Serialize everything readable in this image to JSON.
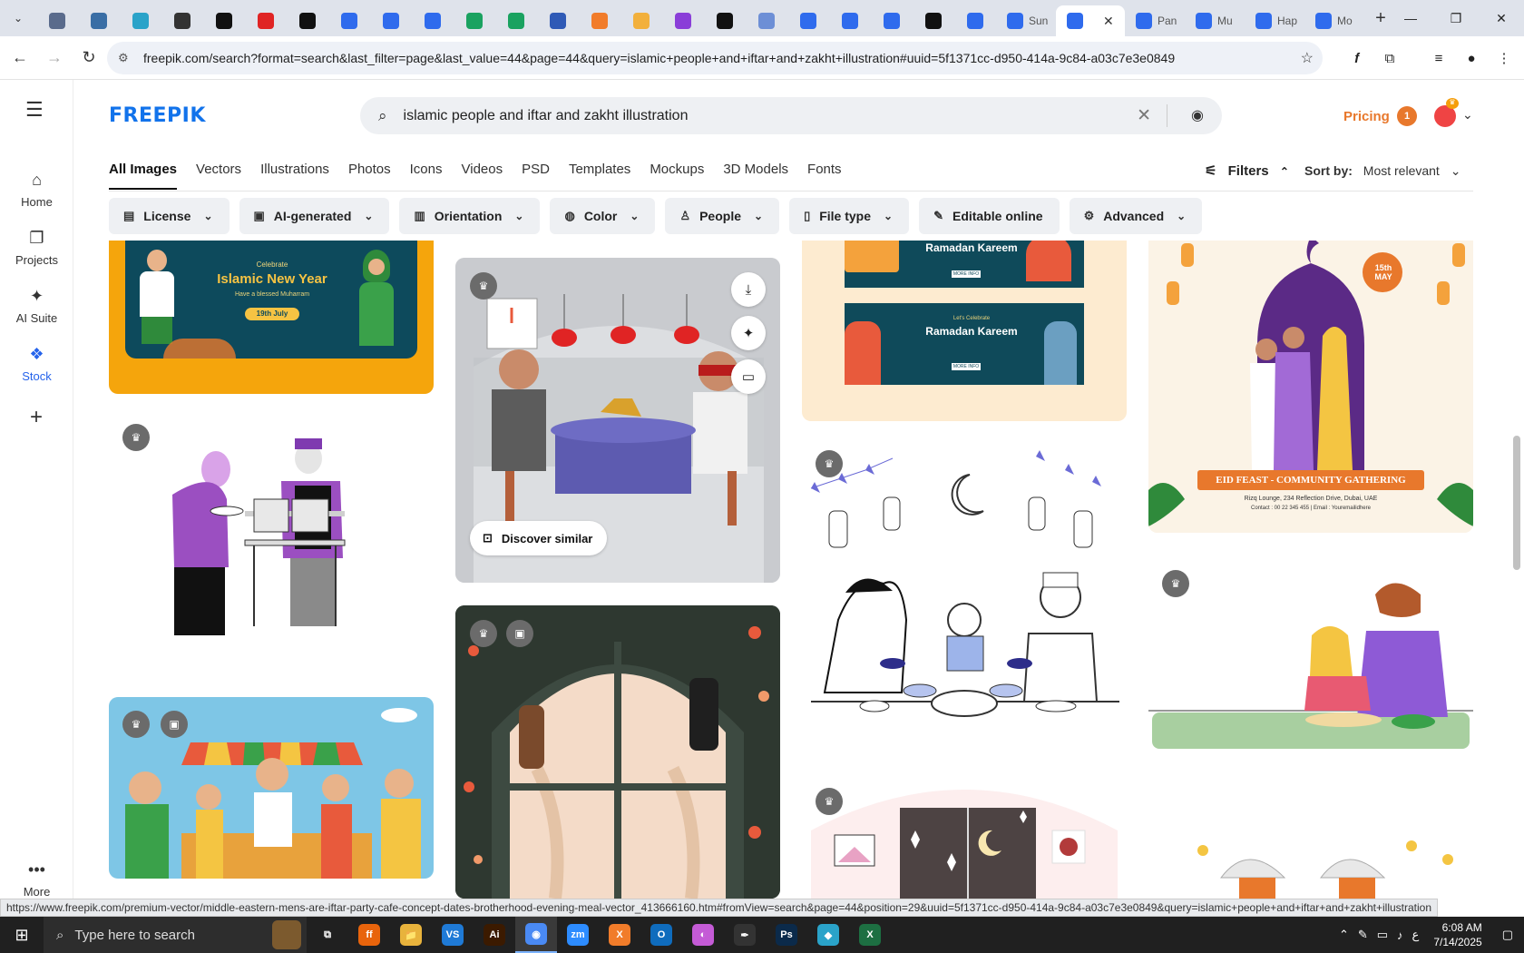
{
  "browser": {
    "tabs": [
      {
        "icon": "chrome-generic-icon",
        "color": "#5a6b8c"
      },
      {
        "icon": "vpn-icon",
        "color": "#3a6ea5"
      },
      {
        "icon": "shield-icon",
        "color": "#2aa3c9"
      },
      {
        "icon": "kaspersky-icon",
        "color": "#333"
      },
      {
        "icon": "github-icon",
        "color": "#111"
      },
      {
        "icon": "youtube-icon",
        "color": "#e02424"
      },
      {
        "icon": "bolt-icon",
        "color": "#111"
      },
      {
        "icon": "docs-icon",
        "color": "#2f6bed"
      },
      {
        "icon": "docs-icon",
        "color": "#2f6bed"
      },
      {
        "icon": "docs-icon",
        "color": "#2f6bed"
      },
      {
        "icon": "sheets-icon",
        "color": "#1aa260"
      },
      {
        "icon": "sheets-icon",
        "color": "#1aa260"
      },
      {
        "icon": "word-icon",
        "color": "#2f5ab6"
      },
      {
        "icon": "xampp-icon",
        "color": "#f17c2a"
      },
      {
        "icon": "bolt-icon",
        "color": "#f2b03c"
      },
      {
        "icon": "bracket-icon",
        "color": "#8a3ed8"
      },
      {
        "icon": "tool-icon",
        "color": "#111"
      },
      {
        "icon": "grid-icon",
        "color": "#6d8fd6"
      },
      {
        "icon": "docs-icon",
        "color": "#2f6bed"
      },
      {
        "icon": "docs-icon",
        "color": "#2f6bed"
      },
      {
        "icon": "docs-icon",
        "color": "#2f6bed"
      },
      {
        "icon": "medium-icon",
        "color": "#111"
      },
      {
        "icon": "docs-icon",
        "color": "#2f6bed"
      }
    ],
    "wide_tabs_before": [
      {
        "label": "Sun"
      }
    ],
    "active_tab": {
      "close": "✕"
    },
    "wide_tabs_after": [
      {
        "label": "Pan"
      },
      {
        "label": "Mu"
      },
      {
        "label": "Hap"
      },
      {
        "label": "Mo"
      }
    ],
    "new_tab": "+",
    "window_controls": {
      "minimize": "—",
      "restore": "❐",
      "close": "✕"
    },
    "url": "freepik.com/search?format=search&last_filter=page&last_value=44&page=44&query=islamic+people+and+iftar+and+zakht+illustration#uuid=5f1371cc-d950-414a-9c84-a03c7e3e0849"
  },
  "rail": {
    "items": [
      {
        "label": "Home",
        "icon": "home-icon"
      },
      {
        "label": "Projects",
        "icon": "projects-icon"
      },
      {
        "label": "AI Suite",
        "icon": "sparkle-icon"
      },
      {
        "label": "Stock",
        "icon": "stock-icon",
        "active": true
      }
    ],
    "more_label": "More"
  },
  "header": {
    "logo": "FREEPIK",
    "search_value": "islamic people and iftar and zakht illustration",
    "pricing": "Pricing",
    "notifications_count": "1"
  },
  "type_tabs": [
    "All Images",
    "Vectors",
    "Illustrations",
    "Photos",
    "Icons",
    "Videos",
    "PSD",
    "Templates",
    "Mockups",
    "3D Models",
    "Fonts"
  ],
  "filters_label": "Filters",
  "sort": {
    "label": "Sort by:",
    "value": "Most relevant"
  },
  "chips": [
    {
      "label": "License",
      "icon": "license-icon"
    },
    {
      "label": "AI-generated",
      "icon": "ai-icon"
    },
    {
      "label": "Orientation",
      "icon": "orientation-icon"
    },
    {
      "label": "Color",
      "icon": "palette-icon"
    },
    {
      "label": "People",
      "icon": "people-icon"
    },
    {
      "label": "File type",
      "icon": "file-icon"
    },
    {
      "label": "Editable online",
      "icon": "edit-icon",
      "no_caret": true
    },
    {
      "label": "Advanced",
      "icon": "gear-icon"
    }
  ],
  "cards": {
    "islamic_new_year": {
      "celebrate": "Celebrate",
      "title": "Islamic New Year",
      "subtitle": "Have a blessed Muharram",
      "date": "19th July"
    },
    "ramadan_banner": {
      "small": "Let's Celebrate",
      "title": "Ramadan Kareem",
      "button": "MORE INFO"
    },
    "eid_feast": {
      "title": "EID FEAST - COMMUNITY GATHERING",
      "address": "Rizq Lounge, 234 Reflection Drive, Dubai, UAE",
      "contact": "Contact : 00 22 345 455  |  Email : Youremailidhere",
      "date_day": "15th",
      "date_month": "MAY"
    },
    "discover_similar": "Discover similar"
  },
  "status_url": "https://www.freepik.com/premium-vector/middle-eastern-mens-are-iftar-party-cafe-concept-dates-brotherhood-evening-meal-vector_413666160.htm#fromView=search&page=44&position=29&uuid=5f1371cc-d950-414a-9c84-a03c7e3e0849&query=islamic+people+and+iftar+and+zakht+illustration",
  "taskbar": {
    "search_placeholder": "Type here to search",
    "time": "6:08 AM",
    "date": "7/14/2025",
    "apps": [
      {
        "name": "task-view",
        "color": "#202020",
        "txt": "⧉"
      },
      {
        "name": "firefox",
        "color": "#e8640c",
        "txt": "ff"
      },
      {
        "name": "file-explorer",
        "color": "#e8b33c",
        "txt": "📁"
      },
      {
        "name": "vscode",
        "color": "#1f7ad6",
        "txt": "VS"
      },
      {
        "name": "illustrator",
        "color": "#3b1a00",
        "txt": "Ai"
      },
      {
        "name": "chrome",
        "color": "#4a8af4",
        "txt": "◉",
        "active": true
      },
      {
        "name": "zoom",
        "color": "#2d8cff",
        "txt": "zm"
      },
      {
        "name": "xampp",
        "color": "#f17c2a",
        "txt": "X"
      },
      {
        "name": "outlook",
        "color": "#0f6cbd",
        "txt": "O"
      },
      {
        "name": "paint",
        "color": "#c45bd6",
        "txt": "◐"
      },
      {
        "name": "pen",
        "color": "#333",
        "txt": "✒"
      },
      {
        "name": "photoshop",
        "color": "#0b2a4a",
        "txt": "Ps"
      },
      {
        "name": "app",
        "color": "#2aa3c9",
        "txt": "◆"
      },
      {
        "name": "excel",
        "color": "#1d6f42",
        "txt": "X"
      }
    ]
  }
}
